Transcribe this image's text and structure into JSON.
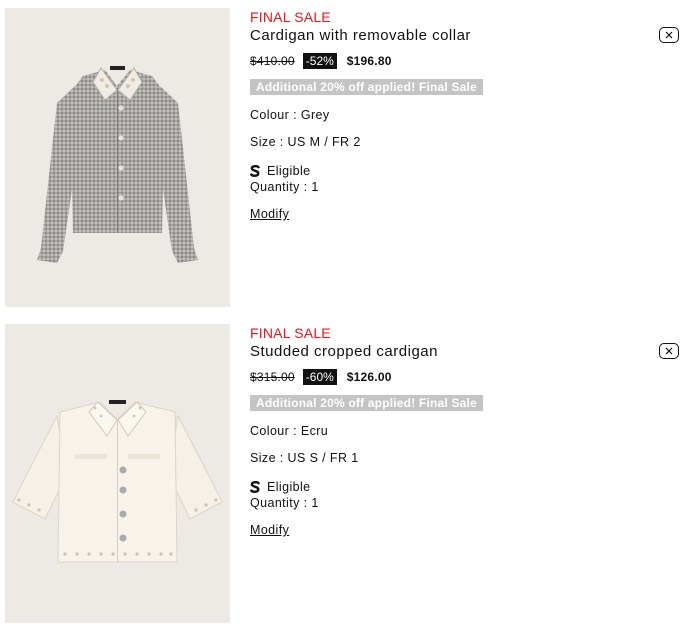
{
  "items": [
    {
      "badge": "FINAL SALE",
      "name": "Cardigan with removable collar",
      "original_price": "$410.00",
      "discount": "-52%",
      "sale_price": "$196.80",
      "promo": "Additional 20% off applied! Final Sale",
      "colour": "Colour : Grey",
      "size": "Size : US M / FR 2",
      "eligible": "Eligible",
      "quantity": "Quantity : 1",
      "modify": "Modify",
      "image_icon": "grey-cardigan-image"
    },
    {
      "badge": "FINAL SALE",
      "name": "Studded cropped cardigan",
      "original_price": "$315.00",
      "discount": "-60%",
      "sale_price": "$126.00",
      "promo": "Additional 20% off applied! Final Sale",
      "colour": "Colour : Ecru",
      "size": "Size : US S / FR 1",
      "eligible": "Eligible",
      "quantity": "Quantity : 1",
      "modify": "Modify",
      "image_icon": "ecru-cardigan-image"
    }
  ],
  "colors": {
    "final_sale": "#e8141b",
    "promo_bg": "#c4c4c4",
    "thumb_bg": "#ede9e4"
  },
  "icons": {
    "remove": "close-icon",
    "eligible": "s-logo-icon"
  }
}
